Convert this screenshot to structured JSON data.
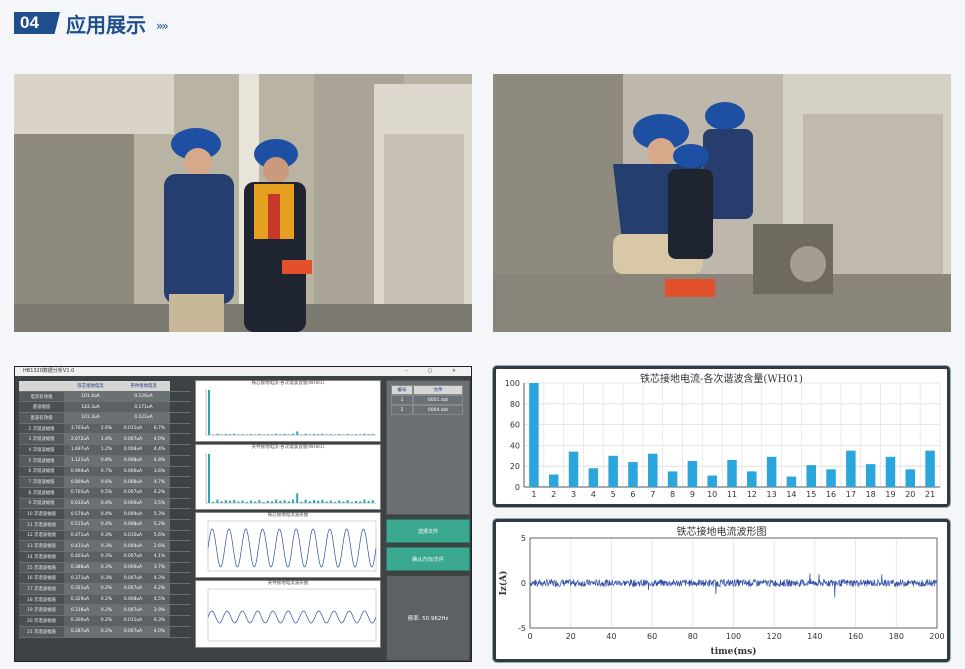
{
  "header": {
    "number": "04",
    "title": "应用展示",
    "chevrons": "»»"
  },
  "software": {
    "window_title": "HB1320数据分析V1.0",
    "window_buttons": "– ▢ ×",
    "table": {
      "headers": [
        "",
        "铁芯接地电流",
        "",
        "夹件接地电流",
        ""
      ],
      "rows": [
        [
          "电流有效值",
          "101.4uA",
          "",
          "0.126uA",
          ""
        ],
        [
          "基波幅值",
          "143.3uA",
          "",
          "0.171uA",
          ""
        ],
        [
          "基波有效值",
          "101.3uA",
          "",
          "0.121uA",
          ""
        ],
        [
          "2 次谐波幅值",
          "3.703uA",
          "2.6%",
          "0.011uA",
          "6.7%"
        ],
        [
          "3 次谐波幅值",
          "2.072uA",
          "1.4%",
          "0.007uA",
          "4.0%"
        ],
        [
          "4 次谐波幅值",
          "1.697uA",
          "1.2%",
          "0.008uA",
          "4.4%"
        ],
        [
          "5 次谐波幅值",
          "1.121uA",
          "0.8%",
          "0.008uA",
          "4.8%"
        ],
        [
          "6 次谐波幅值",
          "0.964uA",
          "0.7%",
          "0.006uA",
          "3.6%"
        ],
        [
          "7 次谐波幅值",
          "0.809uA",
          "0.6%",
          "0.008uA",
          "4.7%"
        ],
        [
          "8 次谐波幅值",
          "0.701uA",
          "0.5%",
          "0.007uA",
          "4.2%"
        ],
        [
          "9 次谐波幅值",
          "0.632uA",
          "0.4%",
          "0.006uA",
          "3.5%"
        ],
        [
          "10 次谐波幅值",
          "0.570uA",
          "0.4%",
          "0.009uA",
          "5.3%"
        ],
        [
          "11 次谐波幅值",
          "0.515uA",
          "0.4%",
          "0.008uA",
          "5.2%"
        ],
        [
          "12 次谐波幅值",
          "0.471uA",
          "0.3%",
          "0.010uA",
          "5.6%"
        ],
        [
          "13 次谐波幅值",
          "0.431uA",
          "0.3%",
          "0.004uA",
          "2.6%"
        ],
        [
          "14 次谐波幅值",
          "0.403uA",
          "0.3%",
          "0.007uA",
          "4.1%"
        ],
        [
          "15 次谐波幅值",
          "0.386uA",
          "0.3%",
          "0.006uA",
          "3.7%"
        ],
        [
          "16 次谐波幅值",
          "0.371uA",
          "0.3%",
          "0.007uA",
          "4.3%"
        ],
        [
          "17 次谐波幅值",
          "0.351uA",
          "0.2%",
          "0.007uA",
          "4.2%"
        ],
        [
          "18 次谐波幅值",
          "0.329uA",
          "0.2%",
          "0.008uA",
          "4.5%"
        ],
        [
          "19 次谐波幅值",
          "0.316uA",
          "0.2%",
          "0.007uA",
          "3.9%"
        ],
        [
          "20 次谐波幅值",
          "0.300uA",
          "0.2%",
          "0.011uA",
          "6.3%"
        ],
        [
          "21 次谐波幅值",
          "0.287uA",
          "0.2%",
          "0.007uA",
          "4.0%"
        ]
      ]
    },
    "plot_titles": [
      "铁芯接地电流-各次谐波含量(WH01)",
      "夹件接地电流-各次谐波含量(WH01)",
      "铁芯接地电流波形图",
      "夹件接地电流波形图"
    ],
    "list_headers": [
      "编号",
      "文件"
    ],
    "list_rows": [
      [
        "1",
        "0001.dat"
      ],
      [
        "2",
        "0004.dat"
      ]
    ],
    "button_open": "选择文件",
    "button_stat": "确认方向/文件",
    "frequency": "频率: 50.962Hz"
  },
  "chart_data": [
    {
      "type": "bar",
      "title": "铁芯接地电流-各次谐波含量(WH01)",
      "categories": [
        "1",
        "2",
        "3",
        "4",
        "5",
        "6",
        "7",
        "8",
        "9",
        "10",
        "11",
        "12",
        "13",
        "14",
        "15",
        "16",
        "17",
        "18",
        "19",
        "20",
        "21"
      ],
      "values": [
        100,
        12,
        34,
        18,
        30,
        24,
        32,
        15,
        25,
        11,
        26,
        15,
        29,
        10,
        21,
        17,
        35,
        22,
        29,
        17,
        35
      ],
      "ylim": [
        0,
        100
      ],
      "yticks": [
        0,
        20,
        40,
        60,
        80,
        100
      ],
      "grid": true,
      "color": "#2aa6dc"
    },
    {
      "type": "line",
      "title": "铁芯接地电流波形图",
      "xlabel": "time(ms)",
      "ylabel": "Iz(A)",
      "xlim": [
        0,
        200
      ],
      "ylim": [
        -5,
        5
      ],
      "xticks": [
        0,
        20,
        40,
        60,
        80,
        100,
        120,
        140,
        160,
        180,
        200
      ],
      "yticks": [
        -5,
        0,
        5
      ],
      "grid": true,
      "color": "#2f4fa8",
      "series_level": 0,
      "noise_amplitude": 0.4
    }
  ],
  "colors": {
    "brand": "#1f4e8c",
    "bar": "#2aa6dc",
    "wave": "#2f4fa8",
    "teal_button": "#3aa98f"
  }
}
